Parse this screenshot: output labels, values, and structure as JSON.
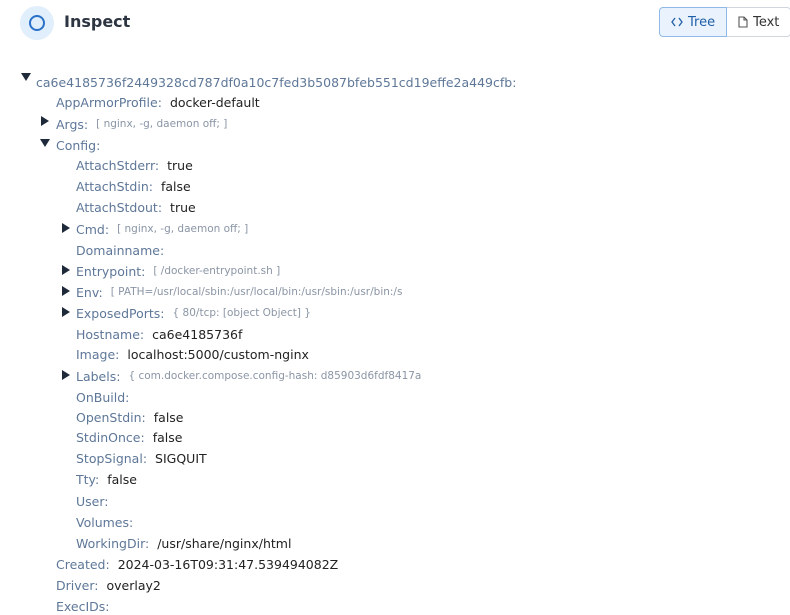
{
  "header": {
    "title": "Inspect",
    "icon": "circle-icon",
    "toggle": {
      "tree_label": "Tree",
      "text_label": "Text",
      "active": "Tree"
    }
  },
  "tree": {
    "root_key": "ca6e4185736f2449328cd787df0a10c7fed3b5087bfeb551cd19effe2a449cfb:",
    "app_armor": {
      "key": "AppArmorProfile:",
      "value": "docker-default"
    },
    "args": {
      "key": "Args:",
      "preview": "[ nginx, -g, daemon off; ]"
    },
    "config": {
      "key": "Config:",
      "attach_stderr": {
        "key": "AttachStderr:",
        "value": "true"
      },
      "attach_stdin": {
        "key": "AttachStdin:",
        "value": "false"
      },
      "attach_stdout": {
        "key": "AttachStdout:",
        "value": "true"
      },
      "cmd": {
        "key": "Cmd:",
        "preview": "[ nginx, -g, daemon off; ]"
      },
      "domainname": {
        "key": "Domainname:",
        "value": ""
      },
      "entrypoint": {
        "key": "Entrypoint:",
        "preview": "[ /docker-entrypoint.sh ]"
      },
      "env": {
        "key": "Env:",
        "preview": "[ PATH=/usr/local/sbin:/usr/local/bin:/usr/sbin:/usr/bin:/s"
      },
      "exposed_ports": {
        "key": "ExposedPorts:",
        "preview": "{ 80/tcp: [object Object] }"
      },
      "hostname": {
        "key": "Hostname:",
        "value": "ca6e4185736f"
      },
      "image": {
        "key": "Image:",
        "value": "localhost:5000/custom-nginx"
      },
      "labels": {
        "key": "Labels:",
        "preview": "{ com.docker.compose.config-hash: d85903d6fdf8417a"
      },
      "on_build": {
        "key": "OnBuild:",
        "value": ""
      },
      "open_stdin": {
        "key": "OpenStdin:",
        "value": "false"
      },
      "stdin_once": {
        "key": "StdinOnce:",
        "value": "false"
      },
      "stop_signal": {
        "key": "StopSignal:",
        "value": "SIGQUIT"
      },
      "tty": {
        "key": "Tty:",
        "value": "false"
      },
      "user": {
        "key": "User:",
        "value": ""
      },
      "volumes": {
        "key": "Volumes:",
        "value": ""
      },
      "working_dir": {
        "key": "WorkingDir:",
        "value": "/usr/share/nginx/html"
      }
    },
    "created": {
      "key": "Created:",
      "value": "2024-03-16T09:31:47.539494082Z"
    },
    "driver": {
      "key": "Driver:",
      "value": "overlay2"
    },
    "exec_ids": {
      "key": "ExecIDs:",
      "value": ""
    }
  }
}
